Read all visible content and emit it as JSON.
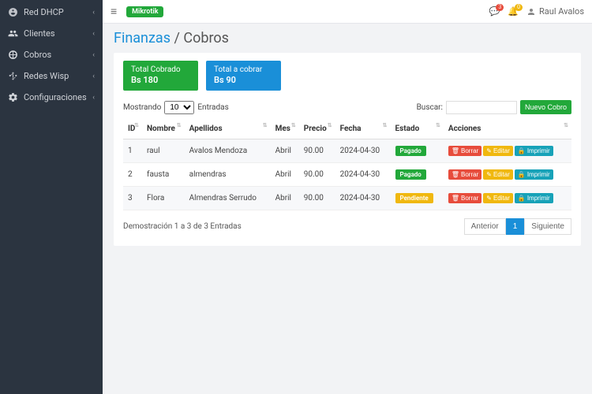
{
  "sidebar": {
    "items": [
      {
        "label": "Red DHCP",
        "icon": "dashboard"
      },
      {
        "label": "Clientes",
        "icon": "users"
      },
      {
        "label": "Cobros",
        "icon": "chart"
      },
      {
        "label": "Redes Wisp",
        "icon": "network"
      },
      {
        "label": "Configuraciones",
        "icon": "gear"
      }
    ]
  },
  "topbar": {
    "system_badge": "Mikrotik",
    "notif_count1": "3",
    "notif_count2": "0",
    "user_name": "Raul Avalos"
  },
  "breadcrumb": {
    "link": "Finanzas",
    "sep": " / ",
    "current": "Cobros"
  },
  "stats": [
    {
      "label": "Total Cobrado",
      "value": "Bs 180",
      "kind": "green"
    },
    {
      "label": "Total a cobrar",
      "value": "Bs 90",
      "kind": "blue"
    }
  ],
  "table_controls": {
    "show_prefix": "Mostrando",
    "show_value": "10",
    "show_suffix": "Entradas",
    "search_label": "Buscar:",
    "search_value": "",
    "new_button": "Nuevo Cobro"
  },
  "columns": [
    "ID",
    "Nombre",
    "Apellidos",
    "Mes",
    "Precio",
    "Fecha",
    "Estado",
    "Acciones"
  ],
  "rows": [
    {
      "id": "1",
      "nombre": "raul",
      "apellidos": "Avalos Mendoza",
      "mes": "Abril",
      "precio": "90.00",
      "fecha": "2024-04-30",
      "estado": "Pagado"
    },
    {
      "id": "2",
      "nombre": "fausta",
      "apellidos": "almendras",
      "mes": "Abril",
      "precio": "90.00",
      "fecha": "2024-04-30",
      "estado": "Pagado"
    },
    {
      "id": "3",
      "nombre": "Flora",
      "apellidos": "Almendras Serrudo",
      "mes": "Abril",
      "precio": "90.00",
      "fecha": "2024-04-30",
      "estado": "Pendiente"
    }
  ],
  "action_labels": {
    "delete": "Borrar",
    "edit": "Editar",
    "print": "Imprimir"
  },
  "footer": {
    "info": "Demostración 1 a 3 de 3 Entradas",
    "prev": "Anterior",
    "page": "1",
    "next": "Siguiente"
  }
}
